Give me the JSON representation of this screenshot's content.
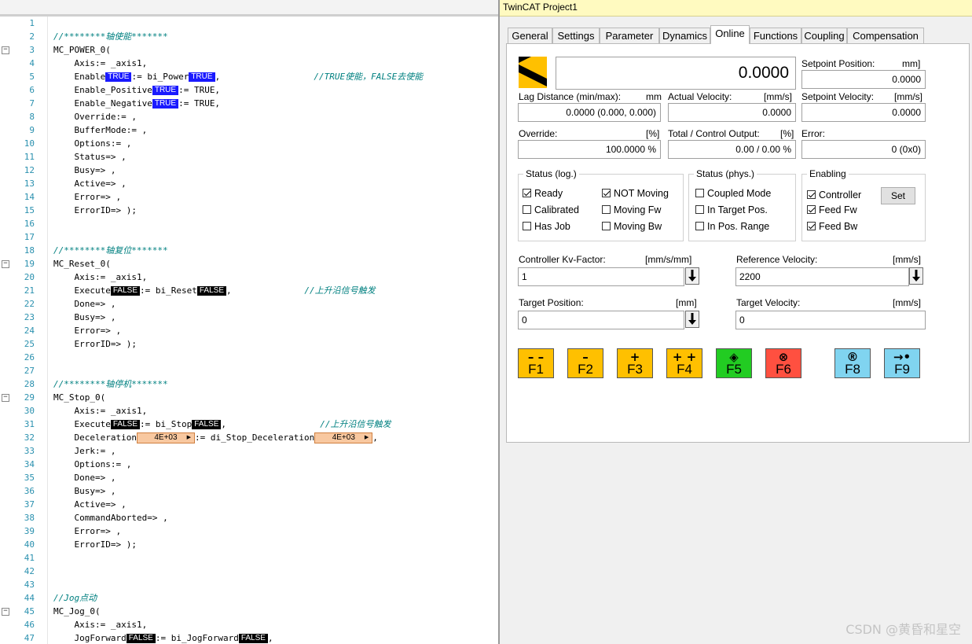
{
  "window": {
    "title": "TwinCAT Project1"
  },
  "tabs": [
    "General",
    "Settings",
    "Parameter",
    "Dynamics",
    "Online",
    "Functions",
    "Coupling",
    "Compensation"
  ],
  "active_tab": "Online",
  "online": {
    "position_value": "0.0000",
    "setpoint_position": {
      "label": "Setpoint Position:",
      "unit": "mm]",
      "value": "0.0000"
    },
    "lag_distance": {
      "label": "Lag Distance (min/max):",
      "unit": "mm",
      "value": "0.0000  (0.000, 0.000)"
    },
    "actual_velocity": {
      "label": "Actual Velocity:",
      "unit": "[mm/s]",
      "value": "0.0000"
    },
    "setpoint_velocity": {
      "label": "Setpoint Velocity:",
      "unit": "[mm/s]",
      "value": "0.0000"
    },
    "override": {
      "label": "Override:",
      "unit": "[%]",
      "value": "100.0000 %"
    },
    "total_output": {
      "label": "Total / Control Output:",
      "unit": "[%]",
      "value": "0.00 /  0.00 %"
    },
    "error": {
      "label": "Error:",
      "value": "0 (0x0)"
    }
  },
  "status_log": {
    "title": "Status (log.)",
    "items": [
      {
        "label": "Ready",
        "checked": true
      },
      {
        "label": "NOT Moving",
        "checked": true
      },
      {
        "label": "Calibrated",
        "checked": false
      },
      {
        "label": "Moving Fw",
        "checked": false
      },
      {
        "label": "Has Job",
        "checked": false
      },
      {
        "label": "Moving Bw",
        "checked": false
      }
    ]
  },
  "status_phys": {
    "title": "Status (phys.)",
    "items": [
      {
        "label": "Coupled Mode",
        "checked": false
      },
      {
        "label": "In Target Pos.",
        "checked": false
      },
      {
        "label": "In Pos. Range",
        "checked": false
      }
    ]
  },
  "enabling": {
    "title": "Enabling",
    "items": [
      {
        "label": "Controller",
        "checked": true
      },
      {
        "label": "Feed Fw",
        "checked": true
      },
      {
        "label": "Feed Bw",
        "checked": true
      }
    ],
    "set_label": "Set"
  },
  "controller_kv": {
    "label": "Controller Kv-Factor:",
    "unit": "[mm/s/mm]",
    "value": "1"
  },
  "reference_velocity": {
    "label": "Reference Velocity:",
    "unit": "[mm/s]",
    "value": "2200"
  },
  "target_position": {
    "label": "Target Position:",
    "unit": "[mm]",
    "value": "0"
  },
  "target_velocity": {
    "label": "Target Velocity:",
    "unit": "[mm/s]",
    "value": "0"
  },
  "function_buttons": [
    {
      "key": "F1",
      "symbol": "– –",
      "color": "#ffc000"
    },
    {
      "key": "F2",
      "symbol": "–",
      "color": "#ffc000"
    },
    {
      "key": "F3",
      "symbol": "+",
      "color": "#ffc000"
    },
    {
      "key": "F4",
      "symbol": "+ +",
      "color": "#ffc000"
    },
    {
      "key": "F5",
      "symbol": "◈",
      "color": "#22cc22"
    },
    {
      "key": "F6",
      "symbol": "⊗",
      "color": "#ff5040"
    },
    {
      "key": "F8",
      "symbol": "®",
      "color": "#80d4f0"
    },
    {
      "key": "F9",
      "symbol": "→•",
      "color": "#80d4f0"
    }
  ],
  "watermark": "CSDN @黄昏和星空",
  "code_lines": [
    {
      "n": "1",
      "segs": []
    },
    {
      "n": "2",
      "segs": [
        {
          "t": "//********轴使能*******",
          "c": "cm"
        }
      ]
    },
    {
      "n": "3",
      "fold": "−",
      "segs": [
        {
          "t": "MC_POWER_0("
        }
      ]
    },
    {
      "n": "4",
      "segs": [
        {
          "t": "    Axis:= _axis1,"
        }
      ]
    },
    {
      "n": "5",
      "segs": [
        {
          "t": "    Enable"
        },
        {
          "t": "TRUE",
          "c": "tok-true"
        },
        {
          "t": ":= bi_Power"
        },
        {
          "t": "TRUE",
          "c": "tok-true"
        },
        {
          "t": ",                  "
        },
        {
          "t": "//TRUE使能，FALSE去使能",
          "c": "cm"
        }
      ]
    },
    {
      "n": "6",
      "segs": [
        {
          "t": "    Enable_Positive"
        },
        {
          "t": "TRUE",
          "c": "tok-true"
        },
        {
          "t": ":= TRUE,"
        }
      ]
    },
    {
      "n": "7",
      "segs": [
        {
          "t": "    Enable_Negative"
        },
        {
          "t": "TRUE",
          "c": "tok-true"
        },
        {
          "t": ":= TRUE,"
        }
      ]
    },
    {
      "n": "8",
      "segs": [
        {
          "t": "    Override:= ,"
        }
      ]
    },
    {
      "n": "9",
      "segs": [
        {
          "t": "    BufferMode:= ,"
        }
      ]
    },
    {
      "n": "10",
      "segs": [
        {
          "t": "    Options:= ,"
        }
      ]
    },
    {
      "n": "11",
      "segs": [
        {
          "t": "    Status=> ,"
        }
      ]
    },
    {
      "n": "12",
      "segs": [
        {
          "t": "    Busy=> ,"
        }
      ]
    },
    {
      "n": "13",
      "segs": [
        {
          "t": "    Active=> ,"
        }
      ]
    },
    {
      "n": "14",
      "segs": [
        {
          "t": "    Error=> ,"
        }
      ]
    },
    {
      "n": "15",
      "segs": [
        {
          "t": "    ErrorID=> );"
        }
      ]
    },
    {
      "n": "16",
      "segs": []
    },
    {
      "n": "17",
      "segs": []
    },
    {
      "n": "18",
      "segs": [
        {
          "t": "//********轴复位*******",
          "c": "cm"
        }
      ]
    },
    {
      "n": "19",
      "fold": "−",
      "segs": [
        {
          "t": "MC_Reset_0("
        }
      ]
    },
    {
      "n": "20",
      "segs": [
        {
          "t": "    Axis:= _axis1,"
        }
      ]
    },
    {
      "n": "21",
      "segs": [
        {
          "t": "    Execute"
        },
        {
          "t": "FALSE",
          "c": "tok-false"
        },
        {
          "t": ":= bi_Reset"
        },
        {
          "t": "FALSE",
          "c": "tok-false"
        },
        {
          "t": ",              "
        },
        {
          "t": "//上升沿信号触发",
          "c": "cm"
        }
      ]
    },
    {
      "n": "22",
      "segs": [
        {
          "t": "    Done=> ,"
        }
      ]
    },
    {
      "n": "23",
      "segs": [
        {
          "t": "    Busy=> ,"
        }
      ]
    },
    {
      "n": "24",
      "segs": [
        {
          "t": "    Error=> ,"
        }
      ]
    },
    {
      "n": "25",
      "segs": [
        {
          "t": "    ErrorID=> );"
        }
      ]
    },
    {
      "n": "26",
      "segs": []
    },
    {
      "n": "27",
      "segs": []
    },
    {
      "n": "28",
      "segs": [
        {
          "t": "//********轴停机*******",
          "c": "cm"
        }
      ]
    },
    {
      "n": "29",
      "fold": "−",
      "segs": [
        {
          "t": "MC_Stop_0("
        }
      ]
    },
    {
      "n": "30",
      "segs": [
        {
          "t": "    Axis:= _axis1,"
        }
      ]
    },
    {
      "n": "31",
      "segs": [
        {
          "t": "    Execute"
        },
        {
          "t": "FALSE",
          "c": "tok-false"
        },
        {
          "t": ":= bi_Stop"
        },
        {
          "t": "FALSE",
          "c": "tok-false"
        },
        {
          "t": ",                  "
        },
        {
          "t": "//上升沿信号触发",
          "c": "cm"
        }
      ]
    },
    {
      "n": "32",
      "segs": [
        {
          "t": "    Deceleration"
        },
        {
          "t": "4E+03",
          "c": "tok-val"
        },
        {
          "t": ":= di_Stop_Deceleration"
        },
        {
          "t": "4E+03",
          "c": "tok-val"
        },
        {
          "t": ","
        }
      ]
    },
    {
      "n": "33",
      "segs": [
        {
          "t": "    Jerk:= ,"
        }
      ]
    },
    {
      "n": "34",
      "segs": [
        {
          "t": "    Options:= ,"
        }
      ]
    },
    {
      "n": "35",
      "segs": [
        {
          "t": "    Done=> ,"
        }
      ]
    },
    {
      "n": "36",
      "segs": [
        {
          "t": "    Busy=> ,"
        }
      ]
    },
    {
      "n": "37",
      "segs": [
        {
          "t": "    Active=> ,"
        }
      ]
    },
    {
      "n": "38",
      "segs": [
        {
          "t": "    CommandAborted=> ,"
        }
      ]
    },
    {
      "n": "39",
      "segs": [
        {
          "t": "    Error=> ,"
        }
      ]
    },
    {
      "n": "40",
      "segs": [
        {
          "t": "    ErrorID=> );"
        }
      ]
    },
    {
      "n": "41",
      "segs": []
    },
    {
      "n": "42",
      "segs": []
    },
    {
      "n": "43",
      "segs": []
    },
    {
      "n": "44",
      "segs": [
        {
          "t": "//Jog点动",
          "c": "cm"
        }
      ]
    },
    {
      "n": "45",
      "fold": "−",
      "segs": [
        {
          "t": "MC_Jog_0("
        }
      ]
    },
    {
      "n": "46",
      "segs": [
        {
          "t": "    Axis:= _axis1,"
        }
      ]
    },
    {
      "n": "47",
      "segs": [
        {
          "t": "    JogForward"
        },
        {
          "t": "FALSE",
          "c": "tok-false"
        },
        {
          "t": ":= bi_JogForward"
        },
        {
          "t": "FALSE",
          "c": "tok-false"
        },
        {
          "t": ","
        }
      ]
    }
  ]
}
